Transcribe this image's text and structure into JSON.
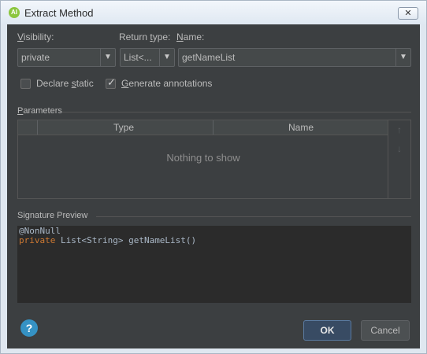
{
  "window": {
    "title": "Extract Method",
    "close_label": "✕"
  },
  "form": {
    "visibility_label_u": "V",
    "visibility_label_rest": "isibility:",
    "visibility_value": "private",
    "return_type_label_pre": "Return ",
    "return_type_label_u": "t",
    "return_type_label_post": "ype:",
    "name_label_u": "N",
    "name_label_rest": "ame:",
    "return_type_value": "List<...",
    "name_value": "getNameList",
    "declare_static_pre": "Declare ",
    "declare_static_u": "s",
    "declare_static_post": "tatic",
    "declare_static_checked": false,
    "generate_annotations_u": "G",
    "generate_annotations_rest": "enerate annotations",
    "generate_annotations_checked": true
  },
  "parameters": {
    "section_label_u": "P",
    "section_label_rest": "arameters",
    "col_type": "Type",
    "col_name": "Name",
    "empty_text": "Nothing to show",
    "move_up_icon": "↑",
    "move_down_icon": "↓"
  },
  "signature": {
    "section_label": "Signature Preview",
    "annotation": "@NonNull",
    "keyword": "private",
    "rest": " List<String> getNameList()"
  },
  "buttons": {
    "help": "?",
    "ok": "OK",
    "cancel": "Cancel"
  },
  "colors": {
    "dark_bg": "#3c3f41",
    "editor_bg": "#2b2b2b",
    "keyword": "#cc7832",
    "ok_button": "#384b63"
  }
}
